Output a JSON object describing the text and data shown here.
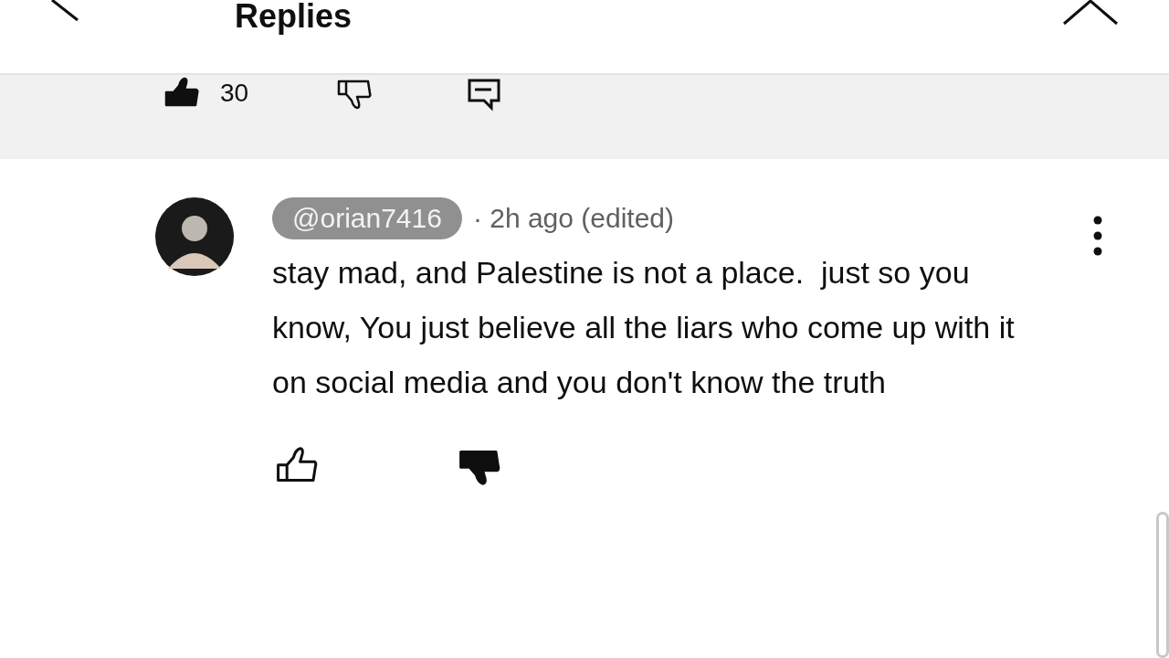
{
  "header": {
    "title": "Replies"
  },
  "parent_actions": {
    "like_count": "30",
    "liked": true,
    "disliked": false
  },
  "reply": {
    "handle": "@orian7416",
    "meta": "· 2h ago (edited)",
    "text": "stay mad, and Palestine is not a place.  just so you know, You just believe all the liars who come up with it on social media and you don't know the truth",
    "liked": false,
    "disliked": true
  }
}
